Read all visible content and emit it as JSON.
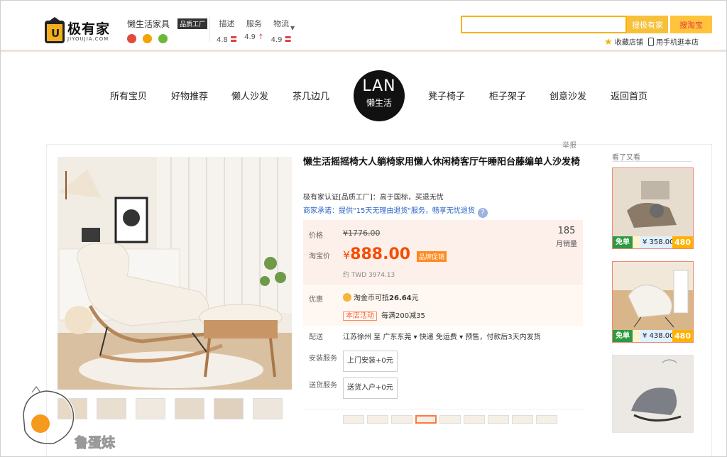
{
  "header": {
    "logo_cn": "极有家",
    "logo_en": "JIYOUJIA.COM",
    "shop_name": "懒生活家具",
    "shop_badge": "品质工厂",
    "dsr": [
      {
        "label": "描述",
        "value": "4.8"
      },
      {
        "label": "服务",
        "value": "4.9"
      },
      {
        "label": "物流",
        "value": "4.9"
      }
    ],
    "search_placeholder": "",
    "search_btn_site": "搜极有家",
    "search_btn_taobao": "搜淘宝",
    "fav_label": "收藏店铺",
    "mobile_label": "用手机逛本店"
  },
  "nav": {
    "items_left": [
      "所有宝贝",
      "好物推荐",
      "懒人沙发",
      "茶几边几"
    ],
    "items_right": [
      "凳子椅子",
      "柜子架子",
      "创意沙发",
      "返回首页"
    ],
    "brand_logo": "LAN",
    "brand_sub": "懒生活"
  },
  "product": {
    "report": "举报",
    "title": "懒生活摇摇椅大人躺椅家用懒人休闲椅客厅午睡阳台藤编单人沙发椅",
    "cert": "极有家认证[品质工厂]：高于国标，买退无忧",
    "promise": "商家承诺：提供\"15天无理由退货\"服务，畅享无忧退货",
    "price_label": "价格",
    "original_price": "¥1776.00",
    "taobao_price_label": "淘宝价",
    "yen": "¥",
    "current_price": "888.00",
    "promo_tag": "品牌促销",
    "twd": "约 TWD 3974.13",
    "sales_count": "185",
    "sales_label": "月销量",
    "discount_label": "优惠",
    "coin_text": "淘金币可抵",
    "coin_amount": "26.64",
    "coin_unit": "元",
    "activity_tag": "本店活动",
    "activity_text": "每满200减35",
    "ship_label": "配送",
    "ship_text": "江苏徐州 至  广东东莞 ▾   快递 免运费 ▾   预售，付款后3天内发货",
    "install_label": "安装服务",
    "install_option": "上门安装+0元",
    "delivery_label": "送货服务",
    "delivery_option": "送货入户+0元"
  },
  "sidebar": {
    "title": "看了又看",
    "items": [
      {
        "tag": "免单",
        "price": "¥ 358.00",
        "big": "480"
      },
      {
        "tag": "免单",
        "price": "¥ 438.00",
        "big": "480"
      },
      {
        "tag": "",
        "price": "",
        "big": ""
      }
    ]
  },
  "watermark": {
    "text": "鲁蛋妹"
  },
  "colors": {
    "accent": "#f54e00",
    "search_border": "#f5b400",
    "link_blue": "#2a64c5"
  }
}
